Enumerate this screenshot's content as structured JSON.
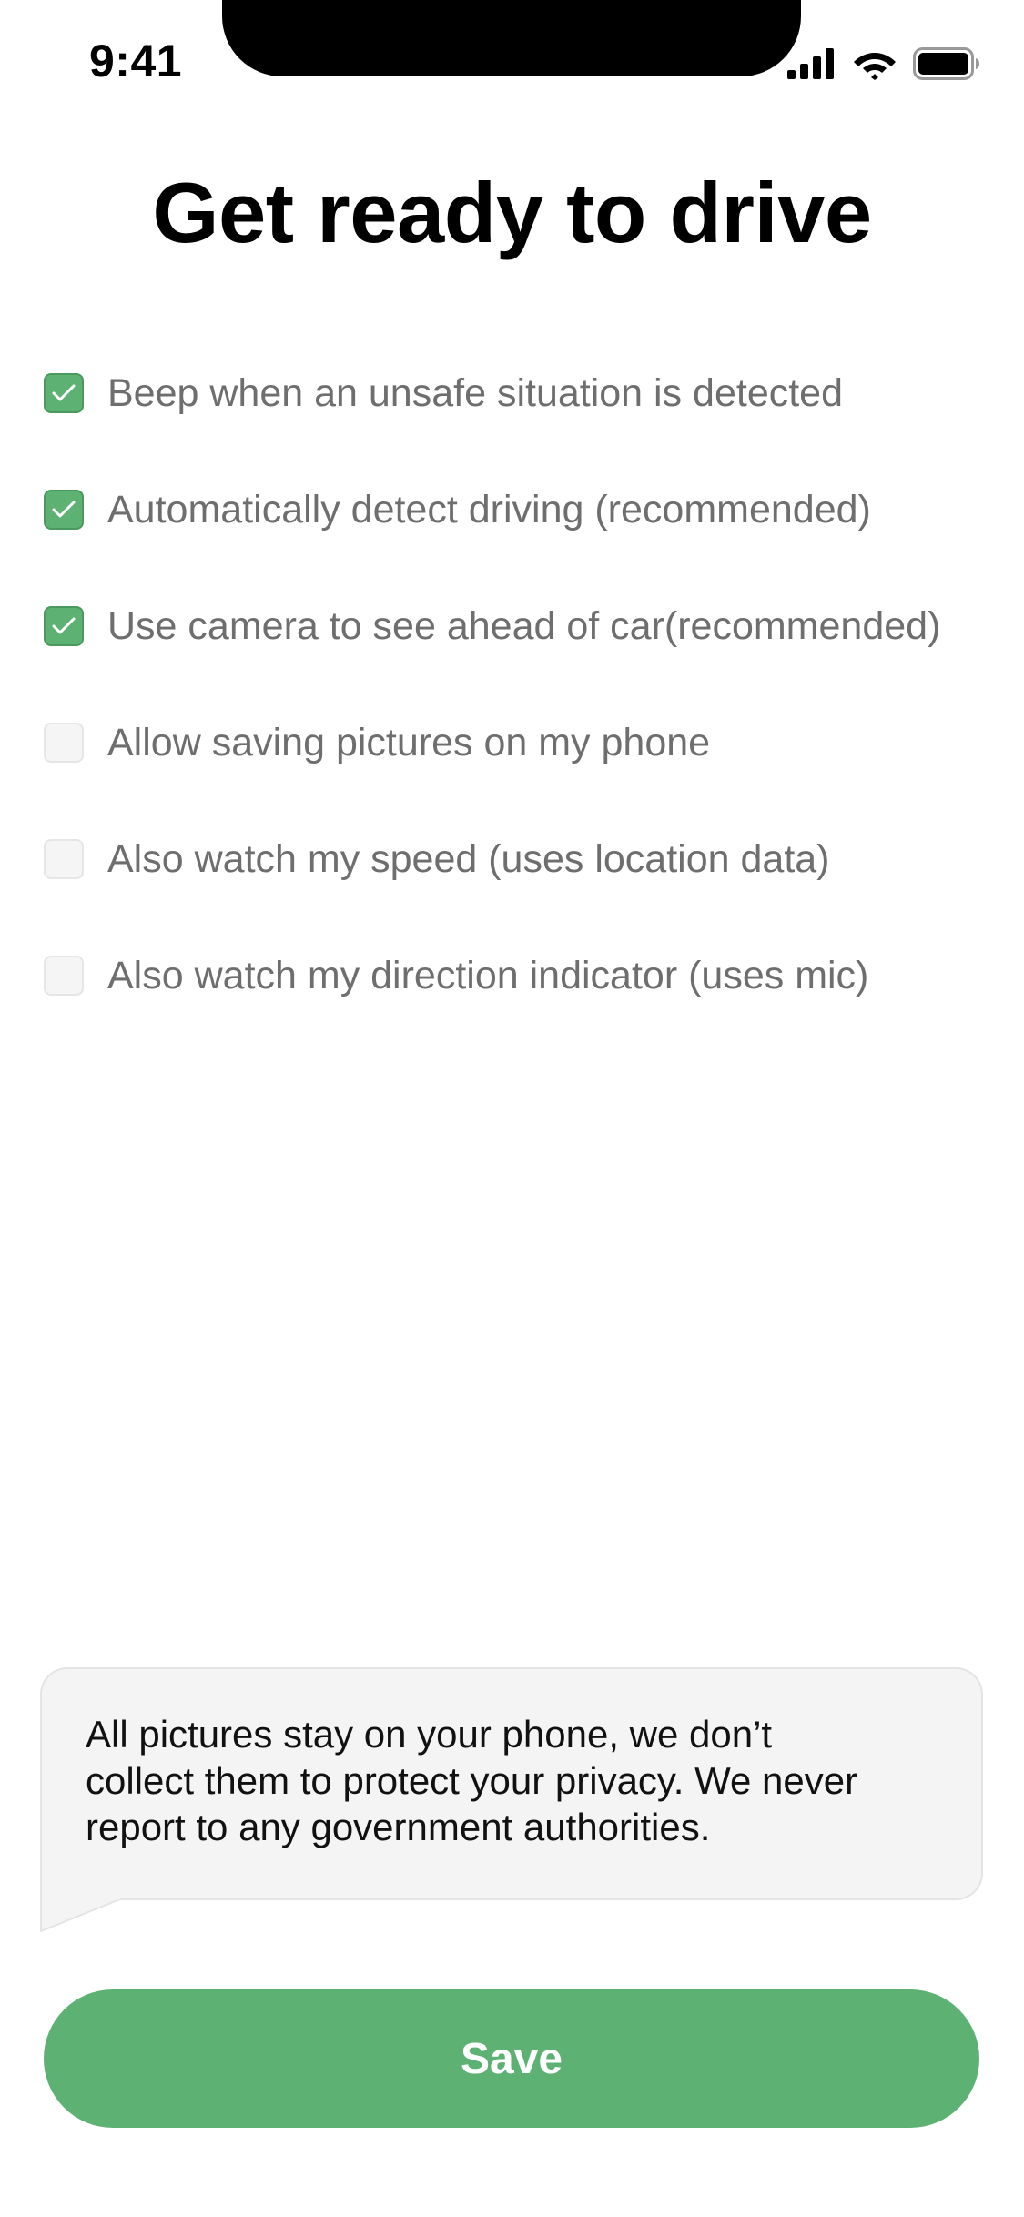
{
  "status_bar": {
    "time": "9:41"
  },
  "title": "Get ready to drive",
  "options": [
    {
      "label": "Beep when an unsafe situation is detected",
      "checked": true
    },
    {
      "label": "Automatically detect driving (recommended)",
      "checked": true
    },
    {
      "label": "Use camera to see ahead of car(recommended)",
      "checked": true
    },
    {
      "label": "Allow saving pictures on my phone",
      "checked": false
    },
    {
      "label": "Also watch my speed (uses location data)",
      "checked": false
    },
    {
      "label": "Also watch my direction indicator (uses mic)",
      "checked": false
    }
  ],
  "info": {
    "line1": "All pictures stay on your phone, we don’t",
    "line2": "collect them to protect your privacy. We never",
    "line3": "report to any government authorities."
  },
  "save_label": "Save",
  "icons": {
    "check": "checkmark-icon",
    "signal": "cellular-signal-icon",
    "wifi": "wifi-icon",
    "battery": "battery-icon"
  },
  "colors": {
    "accent": "#5db173",
    "label": "#6e6e6e",
    "bubble": "#f4f4f4"
  }
}
